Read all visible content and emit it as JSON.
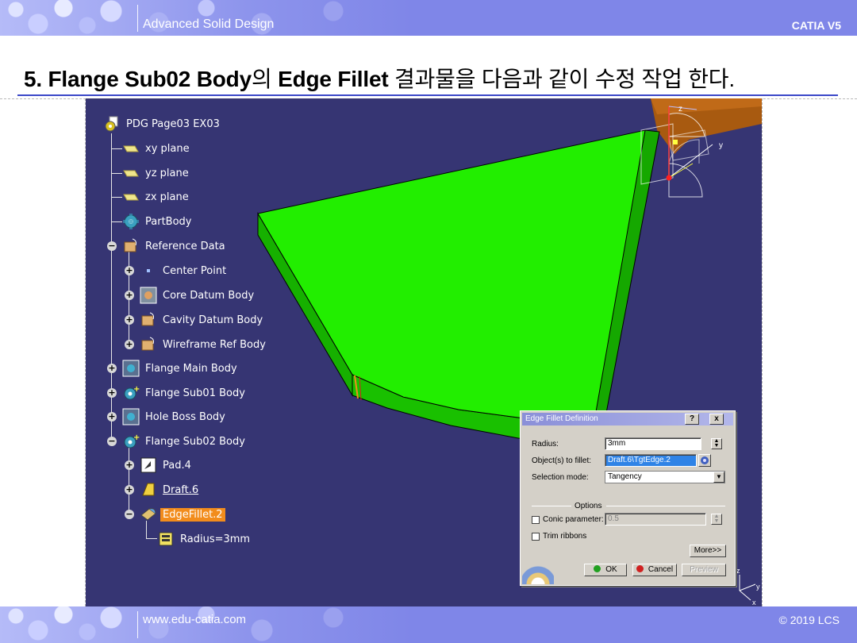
{
  "header": {
    "course_title": "Advanced Solid Design",
    "product": "CATIA V5"
  },
  "footer": {
    "website": "www.edu-catia.com",
    "copyright": "© 2019 LCS"
  },
  "slide": {
    "title_part1": "5. Flange Sub02 Body",
    "title_part2": "의 ",
    "title_part3": "Edge Fillet",
    "title_part4": " 결과물을 다음과 같이 수정 작업 한다."
  },
  "tree": {
    "root": "PDG Page03 EX03",
    "items": [
      {
        "label": "xy plane"
      },
      {
        "label": "yz plane"
      },
      {
        "label": "zx plane"
      },
      {
        "label": "PartBody"
      },
      {
        "label": "Reference Data"
      },
      {
        "label": "Center Point"
      },
      {
        "label": "Core Datum Body"
      },
      {
        "label": "Cavity Datum Body"
      },
      {
        "label": "Wireframe Ref Body"
      },
      {
        "label": "Flange Main Body"
      },
      {
        "label": "Flange Sub01 Body"
      },
      {
        "label": "Hole Boss Body"
      },
      {
        "label": "Flange Sub02 Body"
      },
      {
        "label": "Pad.4"
      },
      {
        "label": "Draft.6"
      },
      {
        "label": "EdgeFillet.2"
      },
      {
        "label": "Radius=3mm"
      }
    ]
  },
  "axes": {
    "x": "x",
    "y": "y",
    "z": "z"
  },
  "dialog": {
    "title": "Edge Fillet Definition",
    "help_button": "?",
    "close_button": "x",
    "radius_label": "Radius:",
    "radius_value": "3mm",
    "objects_label": "Object(s) to fillet:",
    "objects_value": "Draft.6\\TgtEdge.2",
    "selection_mode_label": "Selection mode:",
    "selection_mode_value": "Tangency",
    "options_label": "Options",
    "conic_label": "Conic parameter:",
    "conic_value": "0.5",
    "conic_checked": false,
    "trim_label": "Trim ribbons",
    "trim_checked": false,
    "more_button": "More>>",
    "ok_button": "OK",
    "cancel_button": "Cancel",
    "preview_button": "Preview"
  },
  "colors": {
    "band": "#7f86e8",
    "viewport_bg": "#363573",
    "part_face": "#22ee00",
    "part_side": "#16b000",
    "selected_node": "#f28c1c",
    "title_rule": "#3b48c8"
  }
}
